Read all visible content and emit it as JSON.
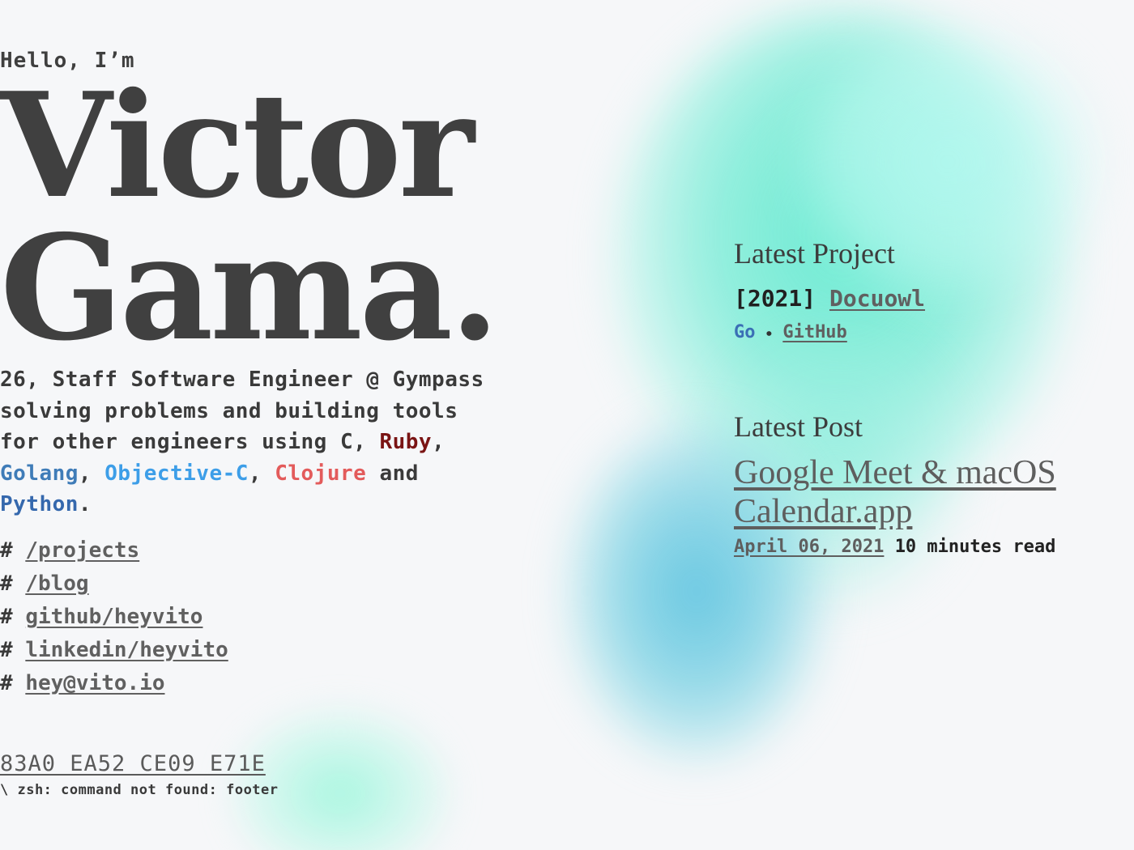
{
  "intro": {
    "greeting": "Hello, I’m",
    "first_name": "Victor",
    "last_name": "Gama."
  },
  "bio": {
    "line_main": "26, Staff Software Engineer @ Gympass",
    "text_a": "solving problems and building tools for other engineers using C, ",
    "ruby": "Ruby",
    "comma1": ", ",
    "golang": "Golang",
    "comma2": ", ",
    "objc": "Objective-C",
    "comma3": ", ",
    "clojure": "Clojure",
    "and": " and ",
    "python": "Python",
    "period": ".",
    "colors": {
      "ruby": "#7a1414",
      "golang": "#3f7cb8",
      "objc": "#3d9ee8",
      "clojure": "#e35b5b",
      "python": "#3568ad"
    }
  },
  "links": [
    {
      "prefix": "#",
      "label": "/projects"
    },
    {
      "prefix": "#",
      "label": "/blog"
    },
    {
      "prefix": "#",
      "label": "github/heyvito"
    },
    {
      "prefix": "#",
      "label": "linkedin/heyvito"
    },
    {
      "prefix": "#",
      "label": "hey@vito.io"
    }
  ],
  "footer": {
    "key": "83A0 EA52 CE09 E71E",
    "note": "\\ zsh: command not found: footer"
  },
  "latest_project": {
    "heading": "Latest Project",
    "year": "[2021]",
    "name": "Docuowl",
    "language": "Go",
    "separator": "🞄",
    "repo": "GitHub"
  },
  "latest_post": {
    "heading": "Latest Post",
    "title": "Google Meet & macOS Calendar.app",
    "date": "April 06, 2021",
    "read_time": "10 minutes read"
  }
}
